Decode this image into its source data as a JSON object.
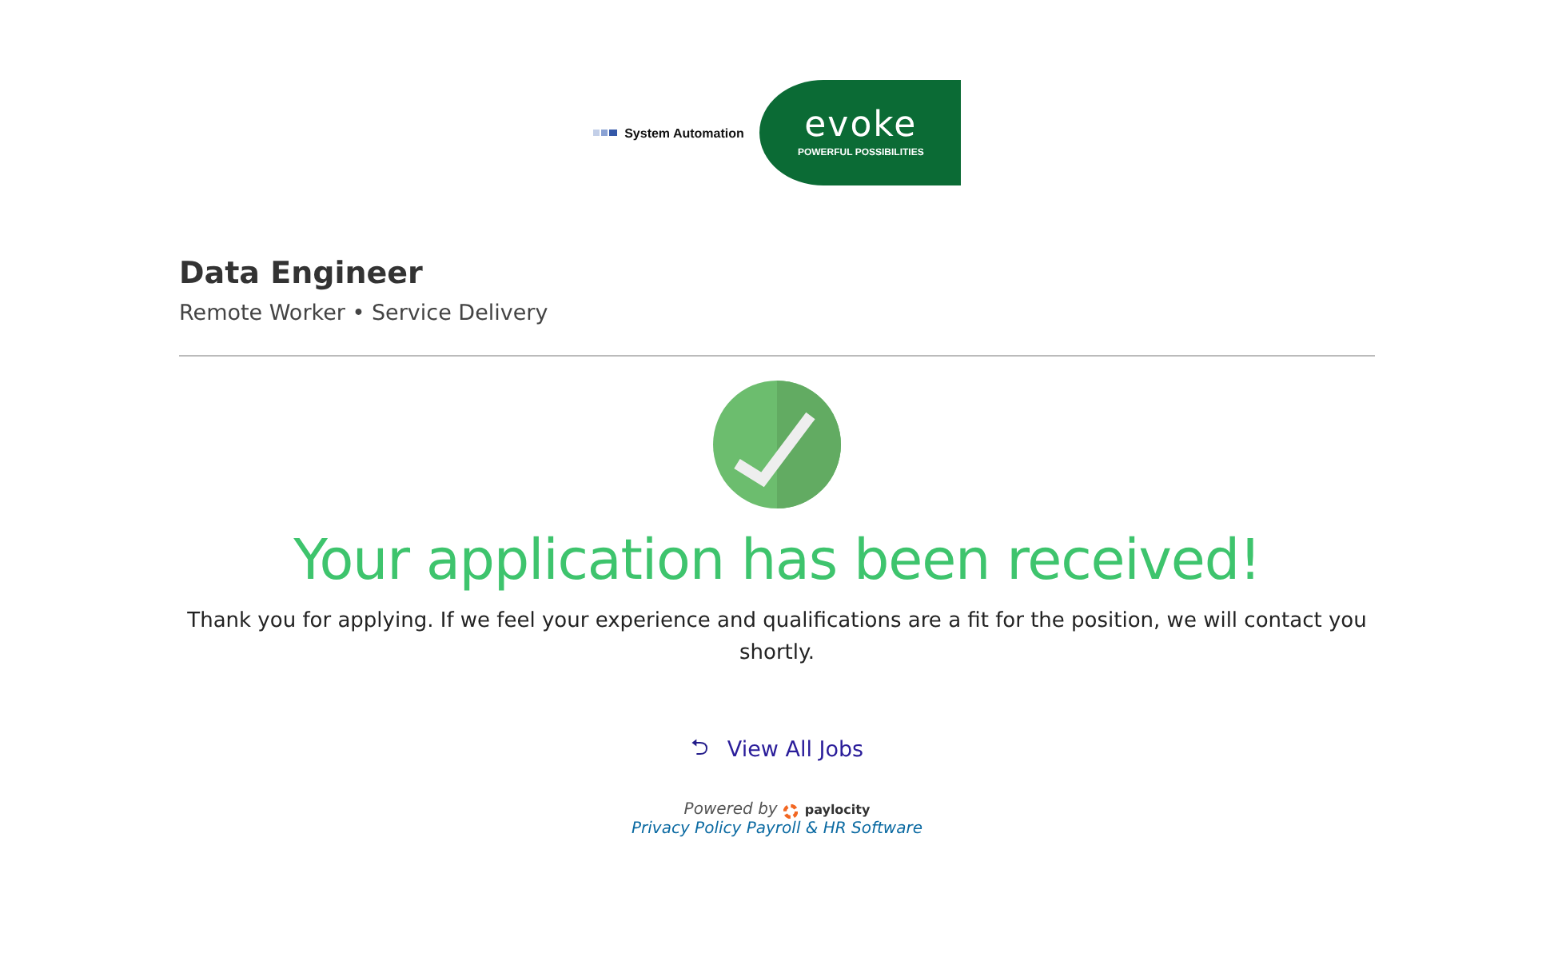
{
  "logos": {
    "company": "System Automation",
    "brand": "evoke",
    "brand_tagline": "POWERFUL POSSIBILITIES"
  },
  "job": {
    "title": "Data Engineer",
    "subtitle": "Remote Worker • Service Delivery"
  },
  "confirmation": {
    "heading": "Your application has been received!",
    "message": "Thank you for applying. If we feel your experience and qualifications are a fit for the position, we will contact you shortly."
  },
  "back_link": {
    "icon": "⮌",
    "label": "View All Jobs"
  },
  "footer": {
    "powered_by": "Powered by",
    "provider": "paylocity",
    "links": [
      "Privacy Policy",
      "Payroll & HR Software"
    ]
  }
}
